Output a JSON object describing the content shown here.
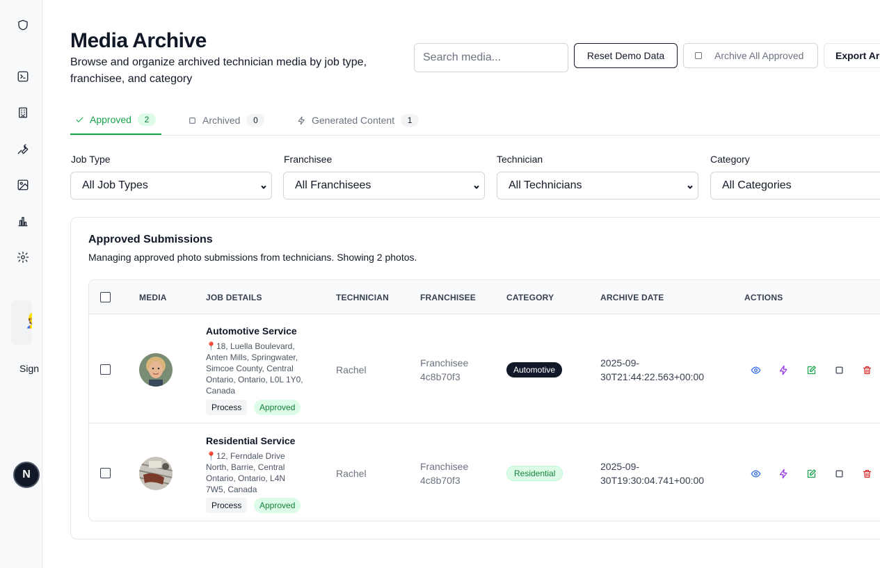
{
  "sidebar": {
    "icons": [
      "shield-icon",
      "terminal-icon",
      "building-icon",
      "wrench-icon",
      "image-icon",
      "bar-chart-icon",
      "gear-icon"
    ],
    "sign_label": "Sign",
    "user_initial": "N"
  },
  "header": {
    "title": "Media Archive",
    "subtitle": "Browse and organize archived technician media by job type, franchisee, and category",
    "search_placeholder": "Search media...",
    "reset_label": "Reset Demo Data",
    "archive_all_label": "Archive All Approved",
    "export_label": "Export Arc"
  },
  "tabs": [
    {
      "label": "Approved",
      "count": "2",
      "icon": "check-icon",
      "active": true
    },
    {
      "label": "Archived",
      "count": "0",
      "icon": "square-icon",
      "active": false
    },
    {
      "label": "Generated Content",
      "count": "1",
      "icon": "zap-icon",
      "active": false
    }
  ],
  "filters": [
    {
      "label": "Job Type",
      "value": "All Job Types"
    },
    {
      "label": "Franchisee",
      "value": "All Franchisees"
    },
    {
      "label": "Technician",
      "value": "All Technicians"
    },
    {
      "label": "Category",
      "value": "All Categories"
    }
  ],
  "card": {
    "title": "Approved Submissions",
    "description": "Managing approved photo submissions from technicians. Showing 2 photos."
  },
  "table": {
    "columns": [
      "MEDIA",
      "JOB DETAILS",
      "TECHNICIAN",
      "FRANCHISEE",
      "CATEGORY",
      "ARCHIVE DATE",
      "ACTIONS"
    ],
    "rows": [
      {
        "job_title": "Automotive Service",
        "address": "📍18, Luella Boulevard, Anten Mills, Springwater, Simcoe County, Central Ontario, Ontario, L0L 1Y0, Canada",
        "stage": "Process",
        "status": "Approved",
        "technician": "Rachel",
        "franchisee": "Franchisee 4c8b70f3",
        "category": "Automotive",
        "archive_date": "2025-09-30T21:44:22.563+00:00"
      },
      {
        "job_title": "Residential Service",
        "address": "📍12, Ferndale Drive North, Barrie, Central Ontario, Ontario, L4N 7W5, Canada",
        "stage": "Process",
        "status": "Approved",
        "technician": "Rachel",
        "franchisee": "Franchisee 4c8b70f3",
        "category": "Residential",
        "archive_date": "2025-09-30T19:30:04.741+00:00"
      }
    ],
    "actions": [
      {
        "icon": "eye-icon",
        "color": "#2563eb"
      },
      {
        "icon": "zap-icon",
        "color": "#9333ea"
      },
      {
        "icon": "edit-icon",
        "color": "#16a34a"
      },
      {
        "icon": "square-icon",
        "color": "#374151"
      },
      {
        "icon": "trash-icon",
        "color": "#dc2626"
      }
    ]
  },
  "colors": {
    "accent_green": "#16a34a",
    "dark": "#111827",
    "muted": "#6b7280"
  }
}
